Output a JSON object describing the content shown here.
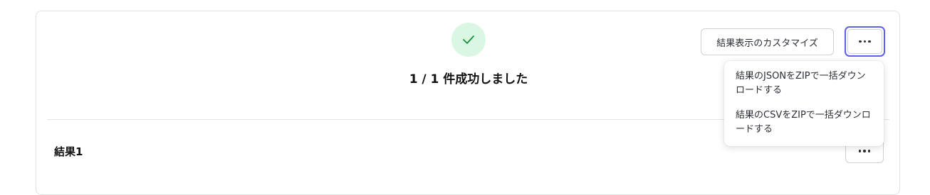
{
  "status": {
    "icon": "check-icon",
    "title": "1 / 1 件成功しました",
    "color": "#1a8f3c",
    "bg_color": "#d9f7e2"
  },
  "toolbar": {
    "customize_label": "結果表示のカスタマイズ",
    "more_icon": "more-horizontal-icon"
  },
  "menu": {
    "items": [
      {
        "label": "結果のJSONをZIPで一括ダウンロードする"
      },
      {
        "label": "結果のCSVをZIPで一括ダウンロードする"
      }
    ]
  },
  "results": [
    {
      "label": "結果1"
    }
  ],
  "colors": {
    "focus_ring": "#5b61e8"
  }
}
